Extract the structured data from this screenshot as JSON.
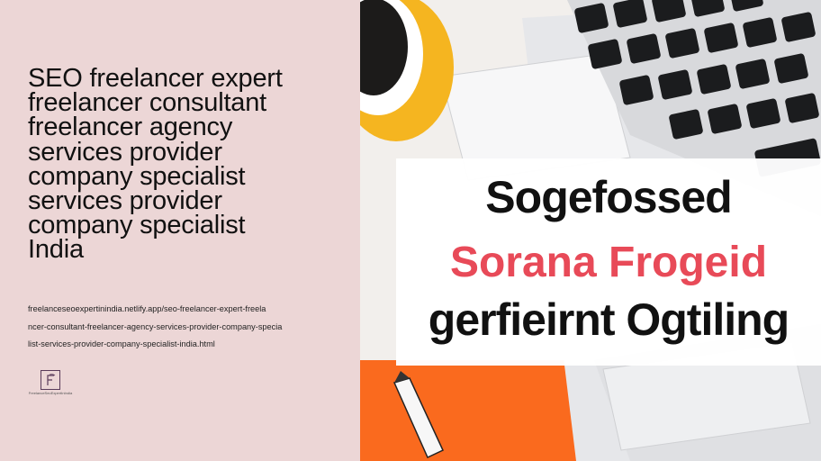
{
  "headline": {
    "lines": [
      "SEO freelancer expert",
      "freelancer consultant",
      "freelancer agency",
      "services provider",
      "company specialist",
      "services provider",
      "company specialist",
      "India"
    ]
  },
  "url": {
    "lines": [
      "freelanceseoexpertinindia.netlify.app/seo-freelancer-expert-freela",
      "ncer-consultant-freelancer-agency-services-provider-company-specia",
      "list-services-provider-company-specialist-india.html"
    ]
  },
  "logo": {
    "letter": "F",
    "caption": "FreelanceSeoExpertInIndia"
  },
  "image": {
    "banner_lines": [
      "Sogefossed",
      "Sorana Frogeid",
      "gerfieirnt Ogtiling"
    ],
    "colors": {
      "accent_red": "#e84a58",
      "orange": "#fa6a1e",
      "cup_yellow": "#f5b520"
    }
  }
}
